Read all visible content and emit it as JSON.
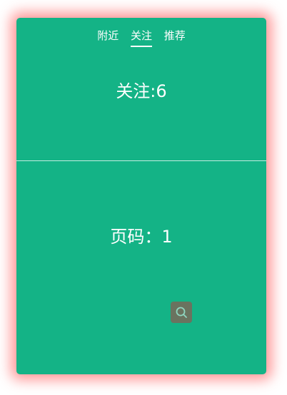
{
  "tabs": [
    {
      "label": "附近",
      "active": false
    },
    {
      "label": "关注",
      "active": true
    },
    {
      "label": "推荐",
      "active": false
    }
  ],
  "content": {
    "follow_text": "关注:6",
    "page_text": "页码：1"
  },
  "icons": {
    "search": "search-icon"
  },
  "colors": {
    "card_bg": "#14b386",
    "glow": "#ff4646",
    "search_button_bg": "#6a735f",
    "search_icon": "#8fd6c0"
  }
}
